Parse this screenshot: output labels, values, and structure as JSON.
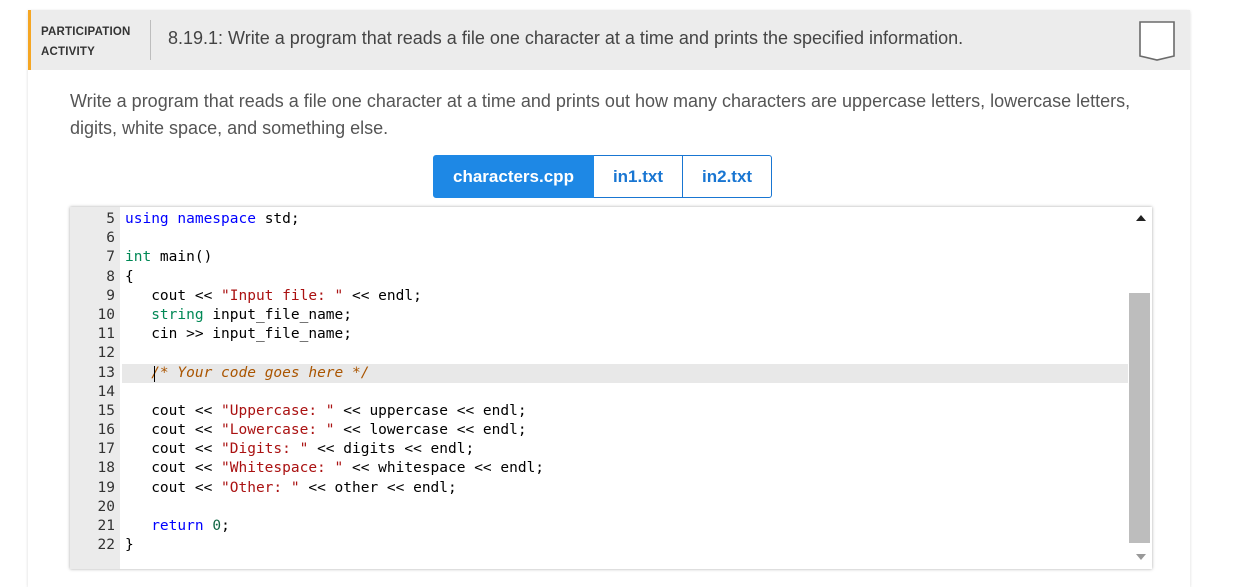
{
  "header": {
    "label_line1": "PARTICIPATION",
    "label_line2": "ACTIVITY",
    "title": "8.19.1: Write a program that reads a file one character at a time and prints the specified information.",
    "accent_color": "#f5a623",
    "bookmark_icon": "bookmark-icon"
  },
  "instructions": "Write a program that reads a file one character at a time and prints out how many characters are uppercase letters, lowercase letters, digits, white space, and something else.",
  "tabs": [
    {
      "label": "characters.cpp",
      "active": true
    },
    {
      "label": "in1.txt",
      "active": false
    },
    {
      "label": "in2.txt",
      "active": false
    }
  ],
  "editor": {
    "lines": [
      {
        "num": "5",
        "text": "using namespace std;"
      },
      {
        "num": "6",
        "text": ""
      },
      {
        "num": "7",
        "text": "int main()"
      },
      {
        "num": "8",
        "text": "{"
      },
      {
        "num": "9",
        "text": "   cout << \"Input file: \" << endl;"
      },
      {
        "num": "10",
        "text": "   string input_file_name;"
      },
      {
        "num": "11",
        "text": "   cin >> input_file_name;"
      },
      {
        "num": "12",
        "text": ""
      },
      {
        "num": "13",
        "text": "   /* Your code goes here */"
      },
      {
        "num": "14",
        "text": ""
      },
      {
        "num": "15",
        "text": "   cout << \"Uppercase: \" << uppercase << endl;"
      },
      {
        "num": "16",
        "text": "   cout << \"Lowercase: \" << lowercase << endl;"
      },
      {
        "num": "17",
        "text": "   cout << \"Digits: \" << digits << endl;"
      },
      {
        "num": "18",
        "text": "   cout << \"Whitespace: \" << whitespace << endl;"
      },
      {
        "num": "19",
        "text": "   cout << \"Other: \" << other << endl;"
      },
      {
        "num": "20",
        "text": ""
      },
      {
        "num": "21",
        "text": "   return 0;"
      },
      {
        "num": "22",
        "text": "}"
      }
    ],
    "highlighted_line": "13"
  }
}
